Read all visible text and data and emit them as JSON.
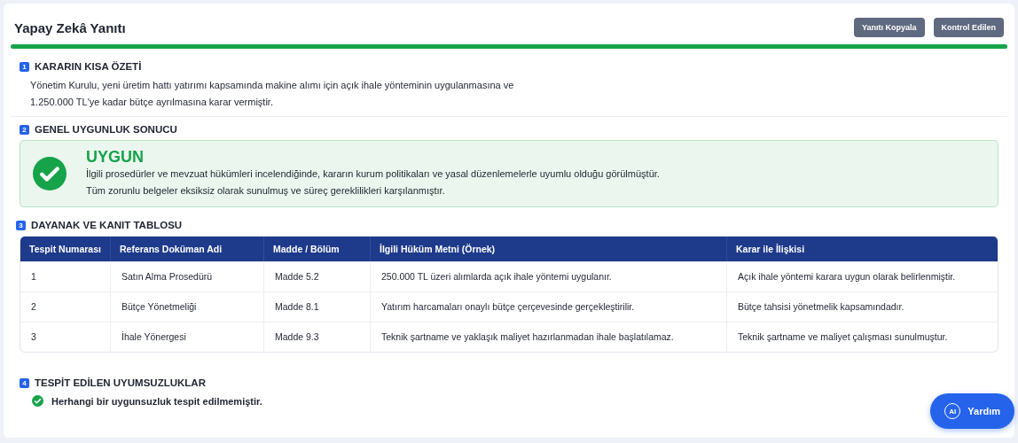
{
  "header": {
    "title": "Yapay Zekâ Yanıtı",
    "buttons": [
      "Yanıtı Kopyala",
      "Kontrol Edilen"
    ],
    "progress": {
      "level": 1
    }
  },
  "summary": {
    "number": "1",
    "title": "KARARIN KISA ÖZETİ",
    "lines": [
      "Yönetim Kurulu, yeni üretim hattı yatırımı kapsamında makine alımı için açık ihale yönteminin uygulanmasına ve",
      "1.250.000 TL'ye kadar bütçe ayrılmasına karar vermiştir."
    ]
  },
  "compliance": {
    "number": "2",
    "title": "GENEL UYGUNLUK SONUCU",
    "passed": true,
    "verdict": "UYGUN",
    "lines": [
      "İlgili prosedürler ve mevzuat hükümleri incelendiğinde, kararın kurum politikaları ve yasal düzenlemelerle uyumlu olduğu görülmüştür.",
      "Tüm zorunlu belgeler eksiksiz olarak sunulmuş ve süreç gereklilikleri karşılanmıştır."
    ]
  },
  "evidence": {
    "number": "3",
    "title": "DAYANAK VE KANIT TABLOSU",
    "columns": [
      "Tespit Numarası",
      "Referans Doküman Adi",
      "Madde / Bölüm",
      "İlgili Hüküm Metni (Örnek)",
      "Karar ile İlişkisi"
    ],
    "rows": [
      [
        "1",
        "Satın Alma Prosedürü",
        "Madde 5.2",
        "250.000 TL üzeri alımlarda açık ihale yöntemi uygulanır.",
        "Açık ihale yöntemi karara uygun olarak belirlenmiştir."
      ],
      [
        "2",
        "Bütçe Yönetmeliği",
        "Madde 8.1",
        "Yatırım harcamaları onaylı bütçe çerçevesinde gerçekleştirilir.",
        "Bütçe tahsisi yönetmelik kapsamındadır."
      ],
      [
        "3",
        "İhale Yönergesi",
        "Madde 9.3",
        "Teknik şartname ve yaklaşık maliyet hazırlanmadan ihale başlatılamaz.",
        "Teknik şartname ve maliyet çalışması sunulmuştur."
      ]
    ]
  },
  "issues": {
    "number": "4",
    "title": "TESPİT EDİLEN UYUMSUZLUKLAR",
    "items": [
      {
        "text": "Herhangi bir uygunsuzluk tespit edilmemiştir.",
        "passed": true
      }
    ]
  },
  "help_button": {
    "badge": "AI",
    "label": "Yardım"
  }
}
